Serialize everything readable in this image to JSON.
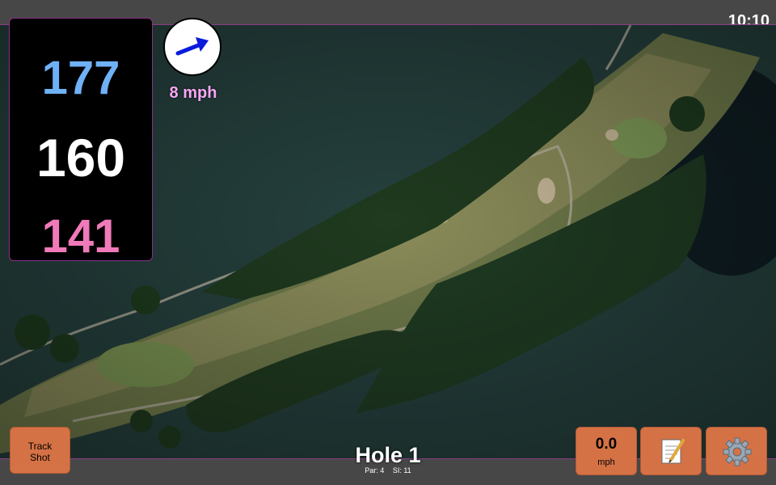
{
  "status": {
    "time": "10:10"
  },
  "distances": {
    "back": "177",
    "center": "160",
    "front": "141"
  },
  "wind": {
    "speed": "8 mph",
    "icon": "wind-arrow-icon",
    "color": "#0a1bdc"
  },
  "hole": {
    "title": "Hole 1",
    "par": "Par: 4",
    "si": "SI: 11"
  },
  "buttons": {
    "track_shot_line1": "Track",
    "track_shot_line2": "Shot",
    "speed_value": "0.0",
    "speed_unit": "mph",
    "notes_icon": "notepad-icon",
    "settings_icon": "gear-icon"
  },
  "colors": {
    "back": "#6fb1f6",
    "center": "#ffffff",
    "front": "#f07ab9",
    "button": "#d57245",
    "accent_border": "#8c2f8a"
  }
}
